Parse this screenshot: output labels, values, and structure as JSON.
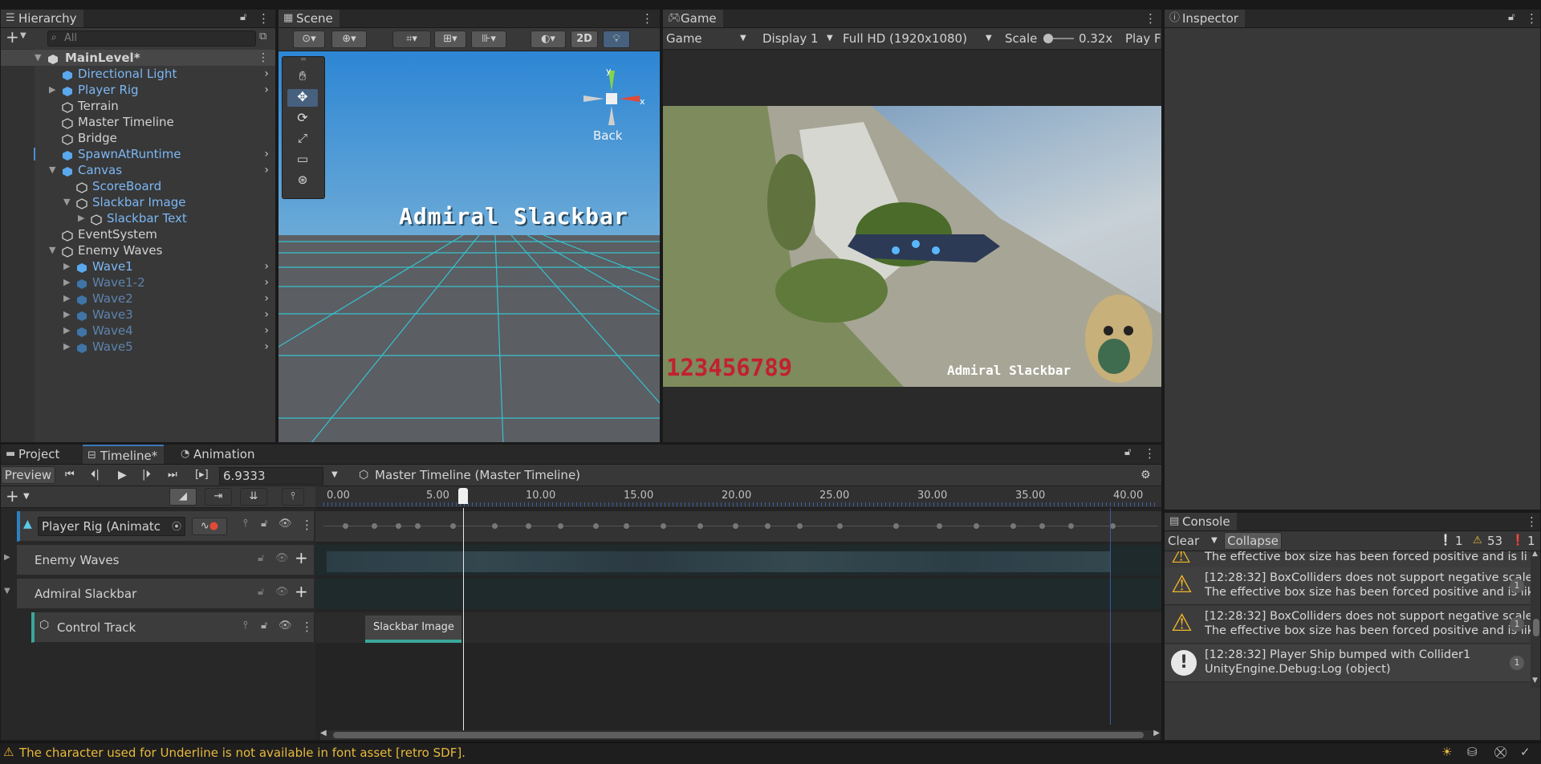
{
  "hierarchy": {
    "title": "Hierarchy",
    "search_placeholder": "All",
    "items": [
      {
        "label": "MainLevel*"
      },
      {
        "label": "Directional Light"
      },
      {
        "label": "Player Rig"
      },
      {
        "label": "Terrain"
      },
      {
        "label": "Master Timeline"
      },
      {
        "label": "Bridge"
      },
      {
        "label": "SpawnAtRuntime"
      },
      {
        "label": "Canvas"
      },
      {
        "label": "ScoreBoard"
      },
      {
        "label": "Slackbar Image"
      },
      {
        "label": "Slackbar Text"
      },
      {
        "label": "EventSystem"
      },
      {
        "label": "Enemy Waves"
      },
      {
        "label": "Wave1"
      },
      {
        "label": "Wave1-2"
      },
      {
        "label": "Wave2"
      },
      {
        "label": "Wave3"
      },
      {
        "label": "Wave4"
      },
      {
        "label": "Wave5"
      }
    ]
  },
  "scene": {
    "title": "Scene",
    "mode_2d": "2D",
    "gizmo_y": "y",
    "gizmo_x": "x",
    "back_label": "Back",
    "overlay_text": "Admiral Slackbar"
  },
  "game": {
    "title": "Game",
    "display_mode": "Game",
    "display": "Display 1",
    "resolution": "Full HD (1920x1080)",
    "scale_label": "Scale",
    "scale_value": "0.32x",
    "play_label": "Play F",
    "score_text": "123456789",
    "name_text": "Admiral Slackbar"
  },
  "inspector": {
    "title": "Inspector"
  },
  "timeline": {
    "tabs": [
      "Project",
      "Timeline*",
      "Animation"
    ],
    "preview_label": "Preview",
    "frame_value": "6.9333",
    "asset_label": "Master Timeline (Master Timeline)",
    "ruler": [
      "0.00",
      "5.00",
      "10.00",
      "15.00",
      "20.00",
      "25.00",
      "30.00",
      "35.00",
      "40.00"
    ],
    "playhead_time": 6.9333,
    "end_time": 40.0,
    "tracks": [
      {
        "label": "Player Rig (Animatc"
      },
      {
        "label": "Enemy Waves"
      },
      {
        "label": "Admiral Slackbar"
      },
      {
        "label": "Control Track"
      }
    ],
    "clip_label": "Slackbar Image"
  },
  "console": {
    "title": "Console",
    "clear_label": "Clear",
    "collapse_label": "Collapse",
    "info_count": "1",
    "warn_count": "53",
    "error_count": "1",
    "entries": [
      {
        "line1": "The effective box size has been forced positive and is li",
        "line2": ""
      },
      {
        "line1": "[12:28:32] BoxColliders does not support negative scale",
        "line2": "The effective box size has been forced positive and is lik",
        "count": "1"
      },
      {
        "line1": "[12:28:32] BoxColliders does not support negative scale",
        "line2": "The effective box size has been forced positive and is lik",
        "count": "1"
      },
      {
        "line1": "[12:28:32] Player Ship bumped with Collider1",
        "line2": "UnityEngine.Debug:Log (object)",
        "count": "1"
      }
    ]
  },
  "statusbar": {
    "message": "The character used for Underline is not available in font asset [retro SDF]."
  }
}
